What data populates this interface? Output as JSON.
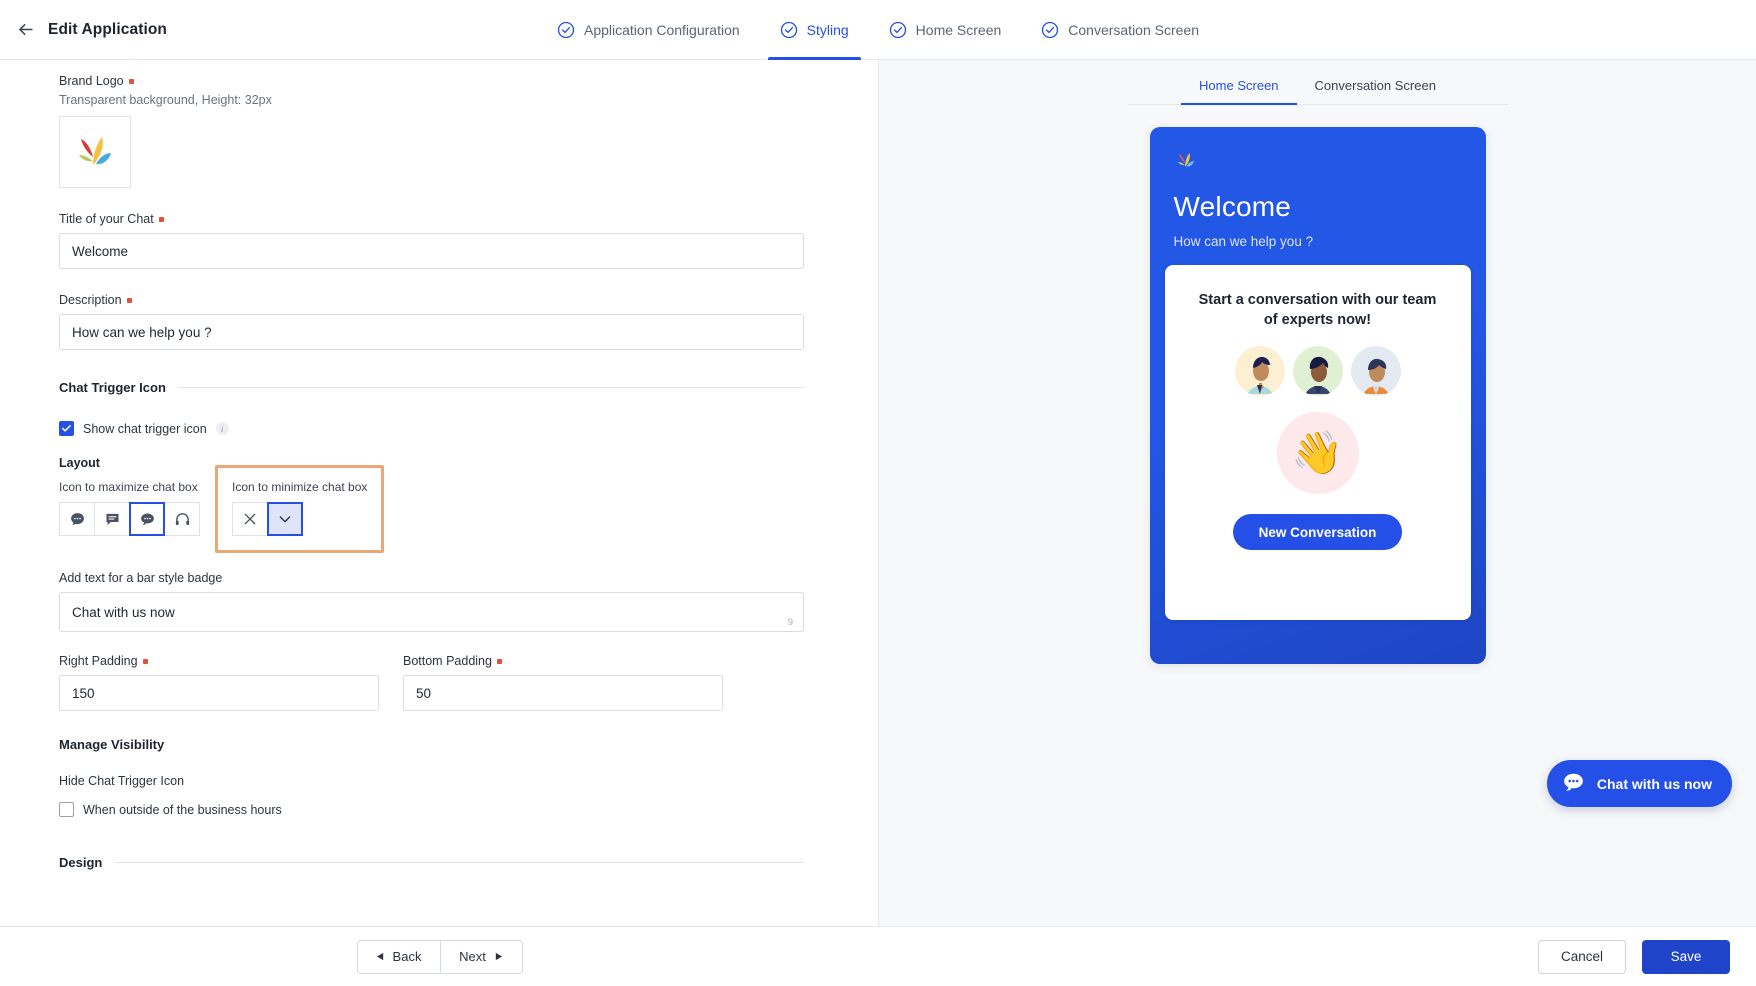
{
  "header": {
    "title": "Edit Application",
    "back_icon": "arrow-left-icon",
    "tabs": [
      {
        "label": "Application Configuration",
        "icon": "check-circle-icon",
        "active": false
      },
      {
        "label": "Styling",
        "icon": "check-circle-icon",
        "active": true
      },
      {
        "label": "Home Screen",
        "icon": "check-circle-icon",
        "active": false
      },
      {
        "label": "Conversation Screen",
        "icon": "check-circle-icon",
        "active": false
      }
    ]
  },
  "form": {
    "brand_logo": {
      "label": "Brand Logo",
      "hint": "Transparent background, Height: 32px",
      "required": true
    },
    "chat_title": {
      "label": "Title of your Chat",
      "value": "Welcome",
      "required": true
    },
    "description": {
      "label": "Description",
      "value": "How can we help you ?",
      "required": true
    },
    "chat_trigger_section": "Chat Trigger Icon",
    "show_trigger": {
      "label": "Show chat trigger icon",
      "checked": true,
      "info_icon": "info-icon"
    },
    "layout_title": "Layout",
    "maximize": {
      "label": "Icon to maximize chat box",
      "options": [
        "chat-bubble-round-icon",
        "chat-bubble-square-icon",
        "chat-bubble-oval-icon",
        "headset-icon"
      ],
      "selected_index": 2
    },
    "minimize": {
      "label": "Icon to minimize chat box",
      "options": [
        "close-x-icon",
        "chevron-down-icon"
      ],
      "selected_index": 1
    },
    "badge_text": {
      "label": "Add text for a bar style badge",
      "value": "Chat with us now",
      "counter": "9"
    },
    "right_padding": {
      "label": "Right Padding",
      "value": "150",
      "required": true
    },
    "bottom_padding": {
      "label": "Bottom Padding",
      "value": "50",
      "required": true
    },
    "manage_visibility_section": "Manage Visibility",
    "hide_trigger_label": "Hide Chat Trigger Icon",
    "outside_hours": {
      "label": "When outside of the business hours",
      "checked": false
    },
    "design_section": "Design"
  },
  "preview": {
    "tabs": [
      {
        "label": "Home Screen",
        "active": true
      },
      {
        "label": "Conversation Screen",
        "active": false
      }
    ],
    "widget": {
      "title": "Welcome",
      "subtitle": "How can we help you ?",
      "card_title": "Start a conversation with our team of experts now!",
      "wave_emoji": "👋",
      "new_conversation_button": "New Conversation"
    },
    "trigger_badge": {
      "label": "Chat with us now",
      "icon": "chat-bubble-oval-icon"
    }
  },
  "footer": {
    "back": "Back",
    "next": "Next",
    "cancel": "Cancel",
    "save": "Save"
  },
  "colors": {
    "accent": "#2550e8",
    "save": "#1f44c9",
    "required": "#e0503a",
    "highlight": "#eaa878"
  }
}
